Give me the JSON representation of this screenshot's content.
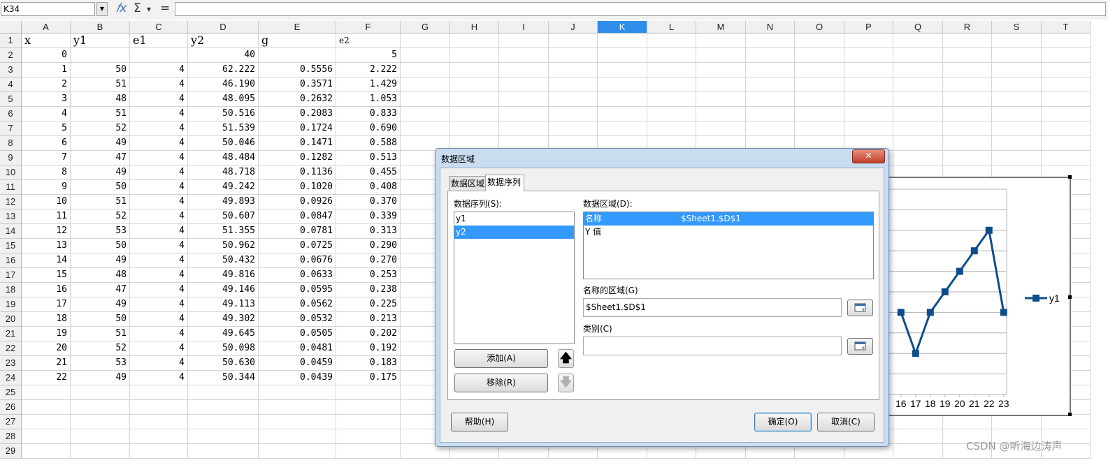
{
  "formula_bar": {
    "name_box": "K34",
    "fx_icon": "𝑓x",
    "sum_icon": "Σ",
    "sum_drop": "▾",
    "equals_icon": "=",
    "formula": ""
  },
  "columns": [
    "A",
    "B",
    "C",
    "D",
    "E",
    "F",
    "G",
    "H",
    "I",
    "J",
    "K",
    "L",
    "M",
    "N",
    "O",
    "P",
    "Q",
    "R",
    "S",
    "T"
  ],
  "active_column": "K",
  "rows": [
    "1",
    "2",
    "3",
    "4",
    "5",
    "6",
    "7",
    "8",
    "9",
    "10",
    "11",
    "12",
    "13",
    "14",
    "15",
    "16",
    "17",
    "18",
    "19",
    "20",
    "21",
    "22",
    "23",
    "24",
    "25",
    "26",
    "27",
    "28",
    "29"
  ],
  "header_row": [
    "x",
    "y1",
    "e1",
    "y2",
    "g",
    "e2"
  ],
  "row2": [
    "0",
    "",
    "",
    "40",
    "",
    "5"
  ],
  "data": [
    [
      "1",
      "50",
      "4",
      "62.222",
      "0.5556",
      "2.222"
    ],
    [
      "2",
      "51",
      "4",
      "46.190",
      "0.3571",
      "1.429"
    ],
    [
      "3",
      "48",
      "4",
      "48.095",
      "0.2632",
      "1.053"
    ],
    [
      "4",
      "51",
      "4",
      "50.516",
      "0.2083",
      "0.833"
    ],
    [
      "5",
      "52",
      "4",
      "51.539",
      "0.1724",
      "0.690"
    ],
    [
      "6",
      "49",
      "4",
      "50.046",
      "0.1471",
      "0.588"
    ],
    [
      "7",
      "47",
      "4",
      "48.484",
      "0.1282",
      "0.513"
    ],
    [
      "8",
      "49",
      "4",
      "48.718",
      "0.1136",
      "0.455"
    ],
    [
      "9",
      "50",
      "4",
      "49.242",
      "0.1020",
      "0.408"
    ],
    [
      "10",
      "51",
      "4",
      "49.893",
      "0.0926",
      "0.370"
    ],
    [
      "11",
      "52",
      "4",
      "50.607",
      "0.0847",
      "0.339"
    ],
    [
      "12",
      "53",
      "4",
      "51.355",
      "0.0781",
      "0.313"
    ],
    [
      "13",
      "50",
      "4",
      "50.962",
      "0.0725",
      "0.290"
    ],
    [
      "14",
      "49",
      "4",
      "50.432",
      "0.0676",
      "0.270"
    ],
    [
      "15",
      "48",
      "4",
      "49.816",
      "0.0633",
      "0.253"
    ],
    [
      "16",
      "47",
      "4",
      "49.146",
      "0.0595",
      "0.238"
    ],
    [
      "17",
      "49",
      "4",
      "49.113",
      "0.0562",
      "0.225"
    ],
    [
      "18",
      "50",
      "4",
      "49.302",
      "0.0532",
      "0.213"
    ],
    [
      "19",
      "51",
      "4",
      "49.645",
      "0.0505",
      "0.202"
    ],
    [
      "20",
      "52",
      "4",
      "50.098",
      "0.0481",
      "0.192"
    ],
    [
      "21",
      "53",
      "4",
      "50.630",
      "0.0459",
      "0.183"
    ],
    [
      "22",
      "49",
      "4",
      "50.344",
      "0.0439",
      "0.175"
    ]
  ],
  "chart_data": {
    "type": "line",
    "legend": [
      "y1"
    ],
    "legend_placement": "right",
    "series_color": "#0e4d8c",
    "visible_x_ticks": [
      "16",
      "17",
      "18",
      "19",
      "20",
      "21",
      "22",
      "23"
    ],
    "series": [
      {
        "name": "y1",
        "x": [
          16,
          17,
          18,
          19,
          20,
          21,
          22,
          23
        ],
        "values": [
          49,
          47,
          49,
          50,
          51,
          52,
          53,
          49
        ]
      }
    ],
    "ylim": [
      45,
      55
    ]
  },
  "dialog": {
    "title": "数据区域",
    "close_label": "✕",
    "tabs": [
      "数据区域",
      "数据序列"
    ],
    "active_tab": "数据序列",
    "series_label": "数据序列(S):",
    "series_items": [
      "y1",
      "y2"
    ],
    "selected_series": "y2",
    "range_label": "数据区域(D):",
    "range_rows": [
      {
        "name": "名称",
        "value": "$Sheet1.$D$1"
      },
      {
        "name": "Y 值",
        "value": ""
      }
    ],
    "name_range_label": "名称的区域(G)",
    "name_range_value": "$Sheet1.$D$1",
    "category_label": "类别(C)",
    "category_value": "",
    "add_button": "添加(A)",
    "remove_button": "移除(R)",
    "up_arrow": "🡅",
    "down_arrow": "🡇",
    "help_button": "帮助(H)",
    "ok_button": "确定(O)",
    "cancel_button": "取消(C)"
  },
  "watermark": "CSDN @听海边涛声"
}
